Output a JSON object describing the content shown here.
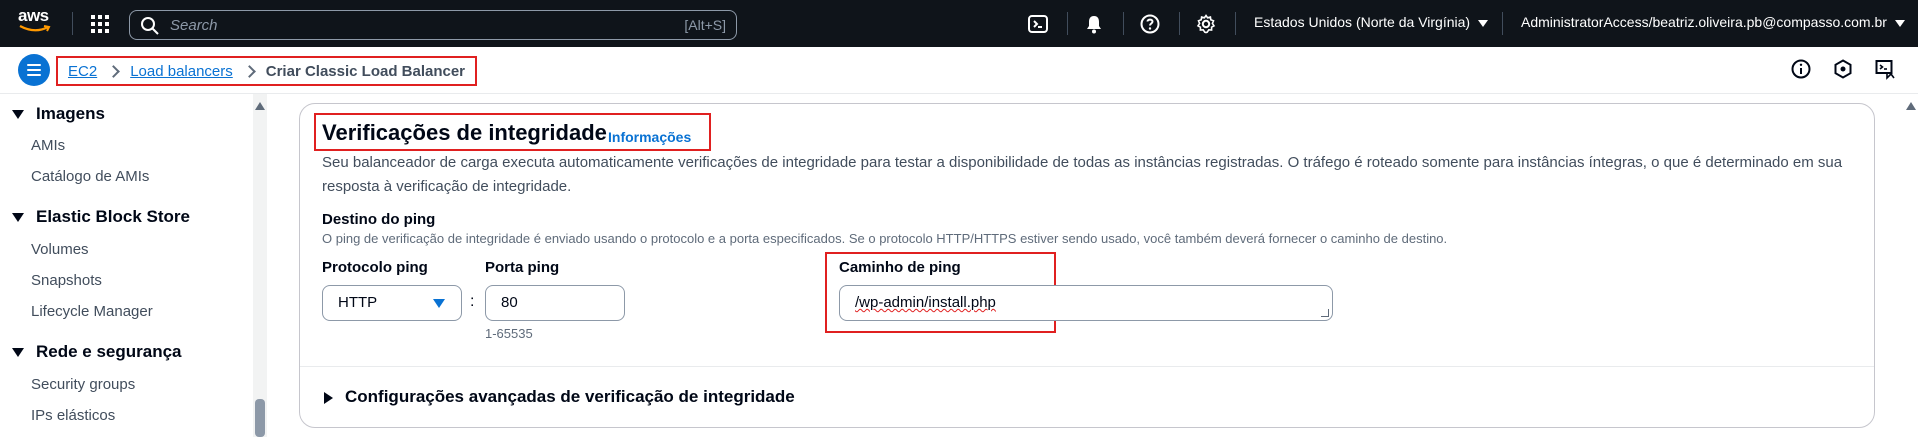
{
  "topnav": {
    "logo_text": "aws",
    "search_placeholder": "Search",
    "search_shortcut": "[Alt+S]",
    "region": "Estados Unidos (Norte da Virgínia)",
    "account": "AdministratorAccess/beatriz.oliveira.pb@compasso.com.br",
    "icons": [
      "services-grid-icon",
      "search-icon",
      "cloudshell-icon",
      "notifications-bell-icon",
      "help-icon",
      "settings-gear-icon"
    ],
    "colors": {
      "background": "#0f141a",
      "text": "#ffffff"
    }
  },
  "breadcrumb": {
    "items": [
      "EC2",
      "Load balancers"
    ],
    "current": "Criar Classic Load Balancer"
  },
  "sidebar": {
    "sections": [
      {
        "title": "Imagens",
        "items": [
          "AMIs",
          "Catálogo de AMIs"
        ]
      },
      {
        "title": "Elastic Block Store",
        "items": [
          "Volumes",
          "Snapshots",
          "Lifecycle Manager"
        ]
      },
      {
        "title": "Rede e segurança",
        "items": [
          "Security groups",
          "IPs elásticos"
        ]
      }
    ]
  },
  "panel": {
    "title": "Verificações de integridade",
    "info_link": "Informações",
    "description": "Seu balanceador de carga executa automaticamente verificações de integridade para testar a disponibilidade de todas as instâncias registradas. O tráfego é roteado somente para instâncias íntegras, o que é determinado em sua resposta à verificação de integridade.",
    "ping_target": {
      "label": "Destino do ping",
      "description": "O ping de verificação de integridade é enviado usando o protocolo e a porta especificados. Se o protocolo HTTP/HTTPS estiver sendo usado, você também deverá fornecer o caminho de destino."
    },
    "protocol": {
      "label": "Protocolo ping",
      "value": "HTTP"
    },
    "separator": ":",
    "port": {
      "label": "Porta ping",
      "value": "80",
      "hint": "1-65535"
    },
    "path": {
      "label": "Caminho de ping",
      "value": "/wp-admin/install.php"
    },
    "advanced_expander": "Configurações avançadas de verificação de integridade"
  },
  "colors": {
    "accent": "#0972d3",
    "highlight_box": "#e02020"
  }
}
